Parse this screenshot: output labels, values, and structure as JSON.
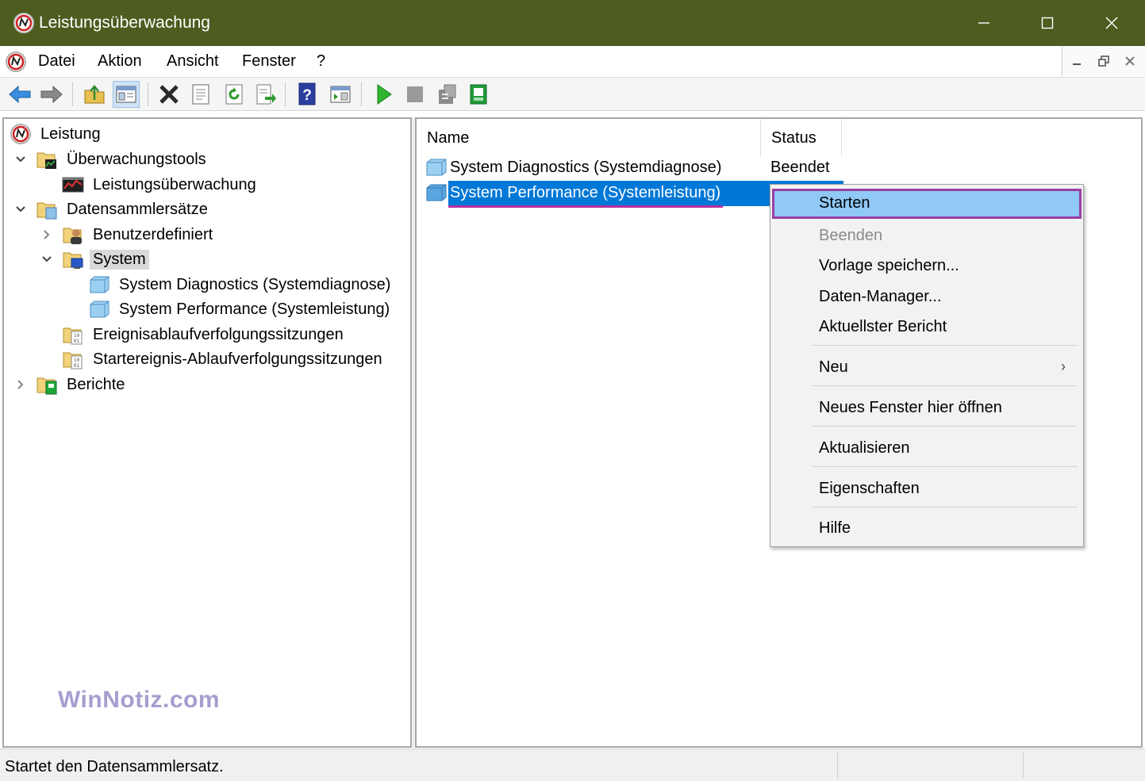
{
  "window": {
    "title": "Leistungsüberwachung"
  },
  "menubar": {
    "items": [
      "Datei",
      "Aktion",
      "Ansicht",
      "Fenster",
      "?"
    ]
  },
  "tree": {
    "items": [
      {
        "label": "Leistung",
        "icon": "perfmon-icon"
      },
      {
        "label": "Überwachungstools",
        "icon": "folder-tools-icon"
      },
      {
        "label": "Leistungsüberwachung",
        "icon": "monitor-graph-icon"
      },
      {
        "label": "Datensammlersätze",
        "icon": "folder-collector-icon"
      },
      {
        "label": "Benutzerdefiniert",
        "icon": "folder-user-icon"
      },
      {
        "label": "System",
        "icon": "folder-system-icon"
      },
      {
        "label": "System Diagnostics (Systemdiagnose)",
        "icon": "datacollector-icon"
      },
      {
        "label": "System Performance (Systemleistung)",
        "icon": "datacollector-icon"
      },
      {
        "label": "Ereignisablaufverfolgungssitzungen",
        "icon": "folder-trace-icon"
      },
      {
        "label": "Startereignis-Ablaufverfolgungssitzungen",
        "icon": "folder-trace-icon"
      },
      {
        "label": "Berichte",
        "icon": "folder-reports-icon"
      }
    ]
  },
  "list": {
    "columns": [
      "Name",
      "Status"
    ],
    "rows": [
      {
        "name": "System Diagnostics (Systemdiagnose)",
        "status": "Beendet"
      },
      {
        "name": "System Performance (Systemleistung)",
        "status": ""
      }
    ]
  },
  "context_menu": {
    "items": [
      {
        "label": "Starten"
      },
      {
        "label": "Beenden"
      },
      {
        "label": "Vorlage speichern..."
      },
      {
        "label": "Daten-Manager..."
      },
      {
        "label": "Aktuellster Bericht"
      },
      {
        "label": "Neu"
      },
      {
        "label": "Neues Fenster hier öffnen"
      },
      {
        "label": "Aktualisieren"
      },
      {
        "label": "Eigenschaften"
      },
      {
        "label": "Hilfe"
      }
    ]
  },
  "watermark": "WinNotiz.com",
  "statusbar": {
    "text": "Startet den Datensammlersatz."
  },
  "colors": {
    "titlebar": "#4d5c1f",
    "selection": "#0078d7",
    "menu_highlight": "#90c8f6",
    "highlight_outline": "#9a3fa6"
  }
}
